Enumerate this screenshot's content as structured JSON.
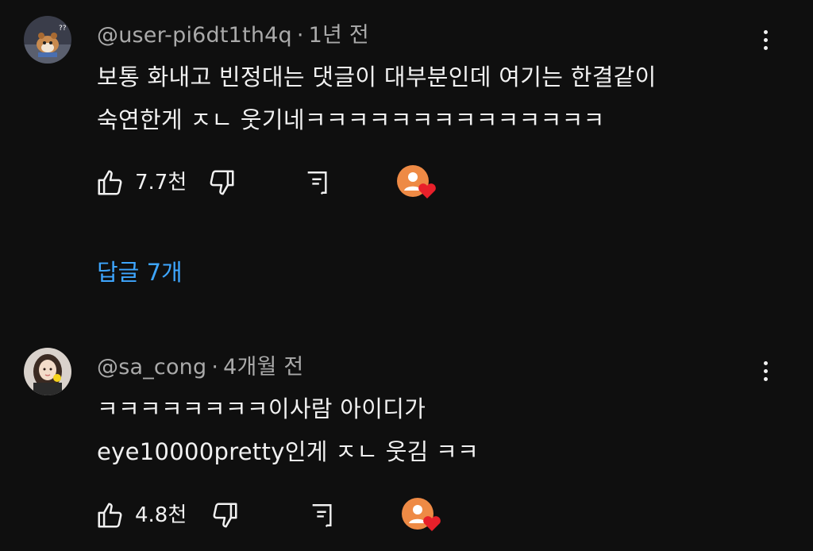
{
  "comments": [
    {
      "author": "@user-pi6dt1th4q",
      "separator": "·",
      "time": "1년 전",
      "lines": [
        "보통 화내고 빈정대는 댓글이 대부분인데 여기는 한결같이",
        "숙연한게 ㅈㄴ 웃기네ㅋㅋㅋㅋㅋㅋㅋㅋㅋㅋㅋㅋㅋㅋ"
      ],
      "like_count": "7.7천",
      "avatar_icon": "dog-avatar",
      "creator_heart_icon": "creator-heart-icon",
      "replies_label": "답글 7개"
    },
    {
      "author": "@sa_cong",
      "separator": "·",
      "time": "4개월 전",
      "lines": [
        "ㅋㅋㅋㅋㅋㅋㅋㅋ이사람 아이디가",
        "eye10000pretty인게 ㅈㄴ 웃김 ㅋㅋ"
      ],
      "like_count": "4.8천",
      "avatar_icon": "girl-avatar",
      "creator_heart_icon": "creator-heart-icon"
    }
  ],
  "colors": {
    "background": "#0f0f0f",
    "text": "#f1f1f1",
    "meta": "#aaaaaa",
    "link": "#3ea6ff",
    "heart": "#e8202a",
    "creator_avatar": "#ee8a45"
  }
}
